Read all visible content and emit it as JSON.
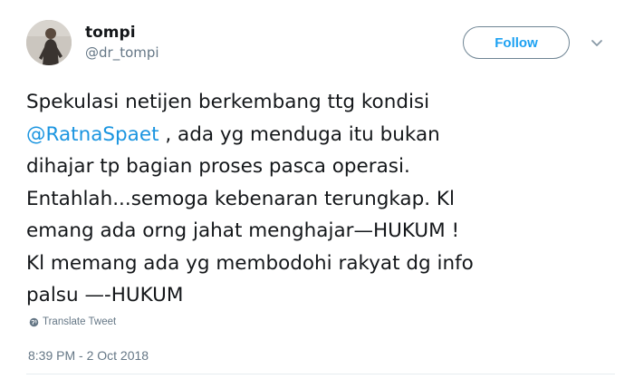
{
  "user": {
    "display_name": "tompi",
    "handle": "@dr_tompi"
  },
  "header": {
    "follow_label": "Follow",
    "caret_icon": "chevron-down-icon"
  },
  "tweet": {
    "lines": [
      {
        "text": "Spekulasi netijen berkembang ttg kondisi"
      },
      {
        "mention": "@RatnaSpaet",
        "text": " , ada yg menduga itu bukan"
      },
      {
        "text": "dihajar tp bagian proses pasca operasi."
      },
      {
        "text": "Entahlah...semoga kebenaran terungkap. Kl"
      },
      {
        "text": "emang ada orng jahat menghajar—HUKUM !"
      },
      {
        "text": "Kl memang ada yg membodohi rakyat dg info"
      },
      {
        "text": "palsu —-HUKUM"
      }
    ]
  },
  "translate_label": "Translate Tweet",
  "translate_icon": "globe-icon",
  "timestamp": "8:39 PM - 2 Oct 2018",
  "colors": {
    "link": "#1b95e0",
    "follow_text": "#1da1f2",
    "secondary": "#657786",
    "primary_text": "#14171a"
  }
}
